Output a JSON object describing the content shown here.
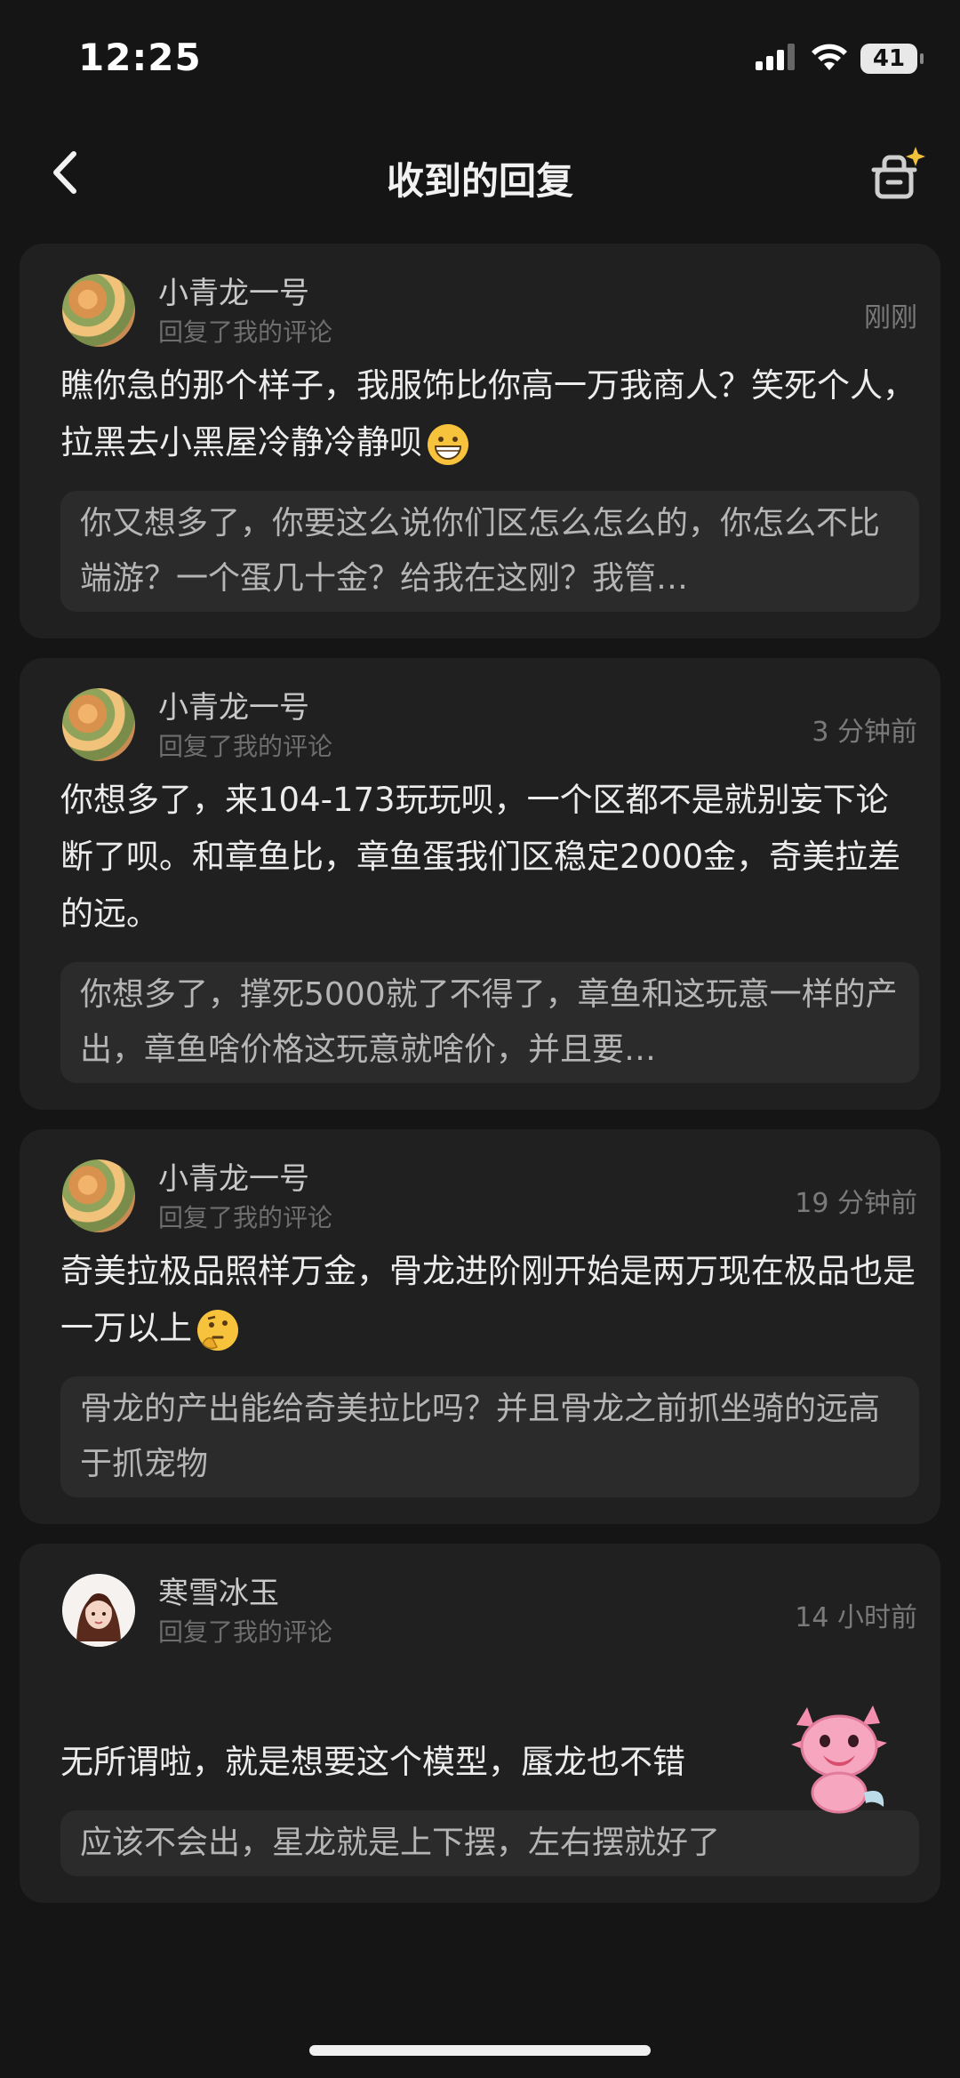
{
  "status": {
    "time": "12:25",
    "battery": "41"
  },
  "nav": {
    "title": "收到的回复"
  },
  "replies": [
    {
      "user": "小青龙一号",
      "sub": "回复了我的评论",
      "time": "刚刚",
      "text": "瞧你急的那个样子，我服饰比你高一万我商人？笑死个人，拉黑去小黑屋冷静冷静呗",
      "emoji": "grinning-face",
      "quote": "你又想多了，你要这么说你们区怎么怎么的，你怎么不比端游？一个蛋几十金？给我在这刚？我管…"
    },
    {
      "user": "小青龙一号",
      "sub": "回复了我的评论",
      "time": "3 分钟前",
      "text": "你想多了，来104-173玩玩呗，一个区都不是就别妄下论断了呗。和章鱼比，章鱼蛋我们区稳定2000金，奇美拉差的远。",
      "quote": "你想多了，撑死5000就了不得了，章鱼和这玩意一样的产出，章鱼啥价格这玩意就啥价，并且要…"
    },
    {
      "user": "小青龙一号",
      "sub": "回复了我的评论",
      "time": "19 分钟前",
      "text": "奇美拉极品照样万金，骨龙进阶刚开始是两万现在极品也是一万以上",
      "emoji": "thinking-face",
      "quote": "骨龙的产出能给奇美拉比吗？并且骨龙之前抓坐骑的远高于抓宠物"
    },
    {
      "user": "寒雪冰玉",
      "sub": "回复了我的评论",
      "time": "14 小时前",
      "text": "无所谓啦，就是想要这个模型，蜃龙也不错",
      "sticker": "pink-axolotl-sticker",
      "quote": "应该不会出，星龙就是上下摆，左右摆就好了"
    }
  ]
}
